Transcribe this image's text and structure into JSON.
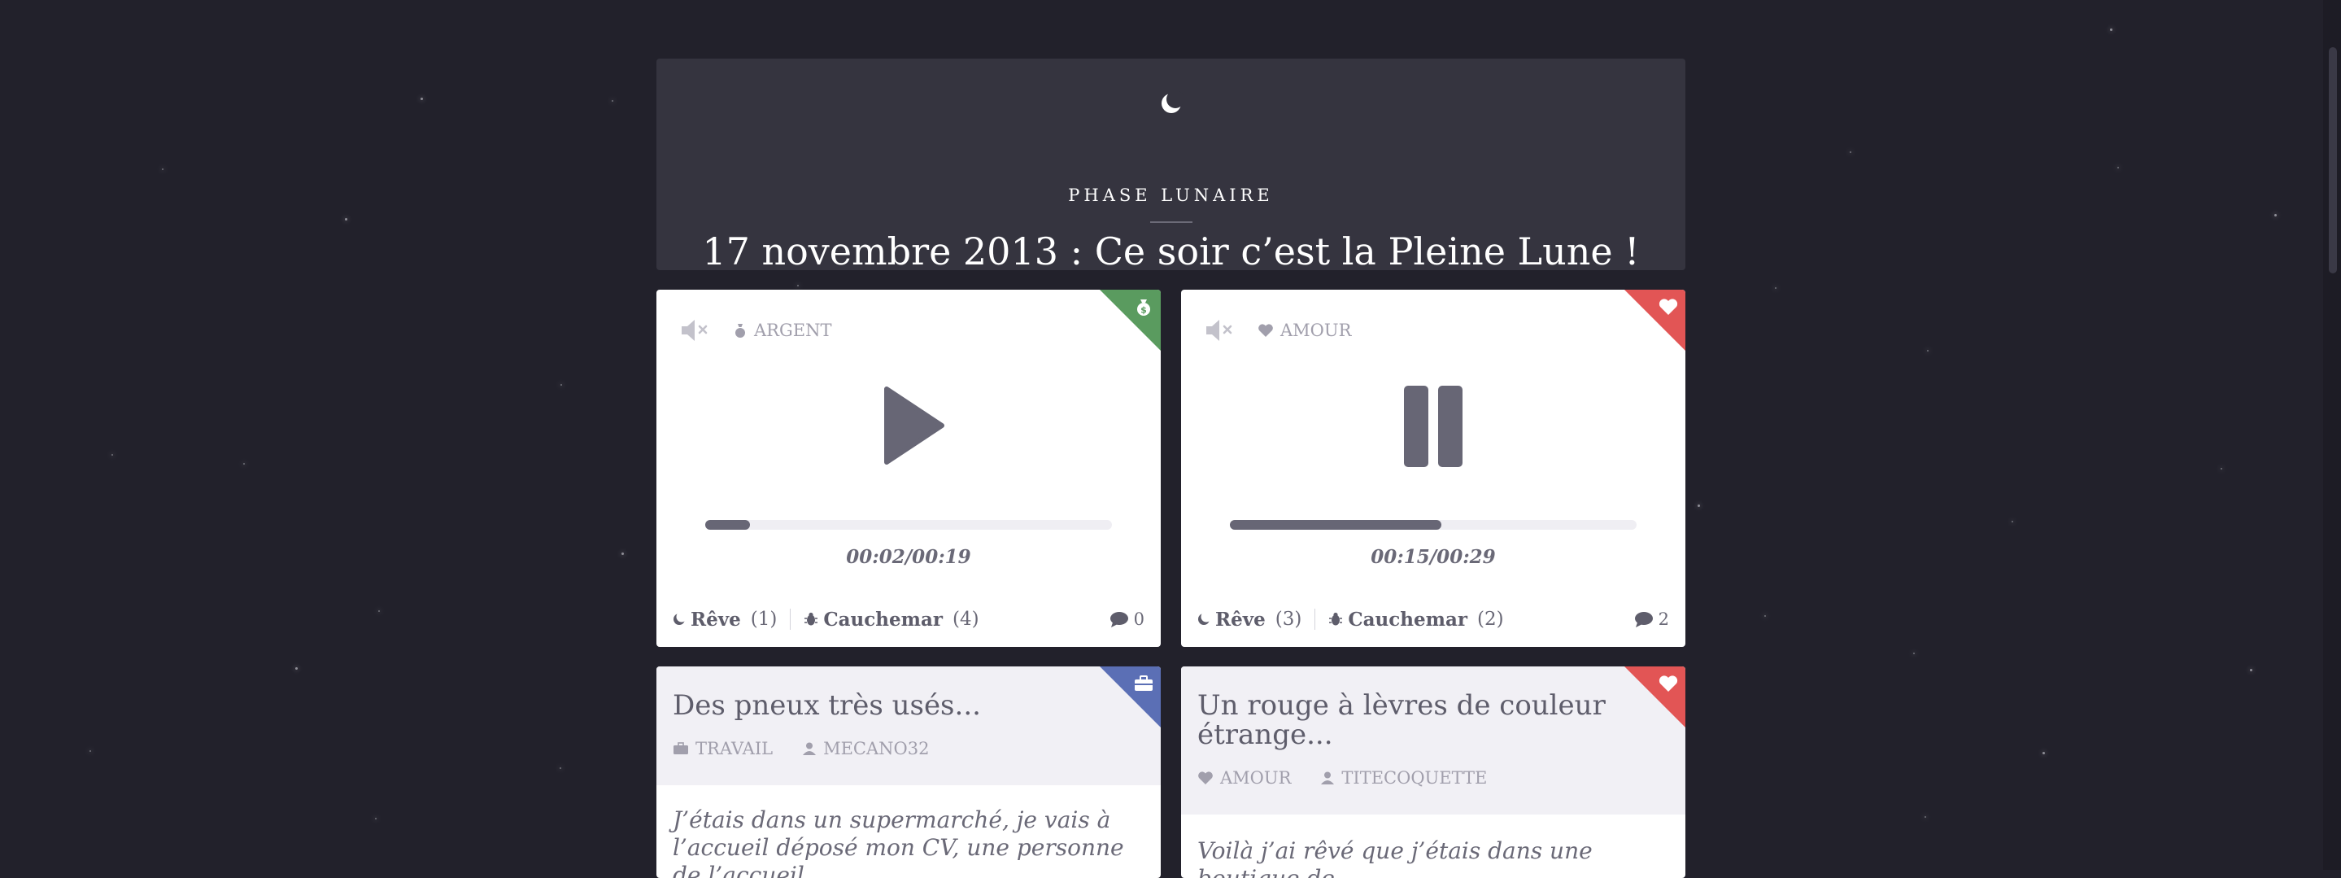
{
  "header": {
    "kicker": "PHASE LUNAIRE",
    "title": "17 novembre 2013 : Ce soir c’est la Pleine Lune !"
  },
  "audio_cards": [
    {
      "category": "ARGENT",
      "corner_color": "#5a9b5f",
      "corner_icon": "money-bag-icon",
      "button_state": "play",
      "progress": 0.11,
      "time": "00:02/00:19",
      "vote_reve_label": "Rêve",
      "vote_reve_count": "(1)",
      "vote_cauchemar_label": "Cauchemar",
      "vote_cauchemar_count": "(4)",
      "comments": "0"
    },
    {
      "category": "AMOUR",
      "corner_color": "#e25555",
      "corner_icon": "heart-icon",
      "button_state": "pause",
      "progress": 0.52,
      "time": "00:15/00:29",
      "vote_reve_label": "Rêve",
      "vote_reve_count": "(3)",
      "vote_cauchemar_label": "Cauchemar",
      "vote_cauchemar_count": "(2)",
      "comments": "2"
    }
  ],
  "story_cards": [
    {
      "title": "Des pneux très usés...",
      "category": "TRAVAIL",
      "author": "MECANO32",
      "corner_color": "#5b6fb5",
      "corner_icon": "briefcase-icon",
      "excerpt": "J’étais dans un supermarché, je vais à l’accueil déposé mon CV, une personne de l’accueil"
    },
    {
      "title": "Un rouge à lèvres de couleur étrange...",
      "category": "AMOUR",
      "author": "TITECOQUETTE",
      "corner_color": "#e25555",
      "corner_icon": "heart-icon",
      "excerpt": "Voilà j’ai rêvé que j’étais dans une boutique de"
    }
  ],
  "colors": {
    "background": "#22212b",
    "header_bg": "#35343f",
    "text_dark": "#5e5d6b",
    "muted": "#a19fac"
  }
}
